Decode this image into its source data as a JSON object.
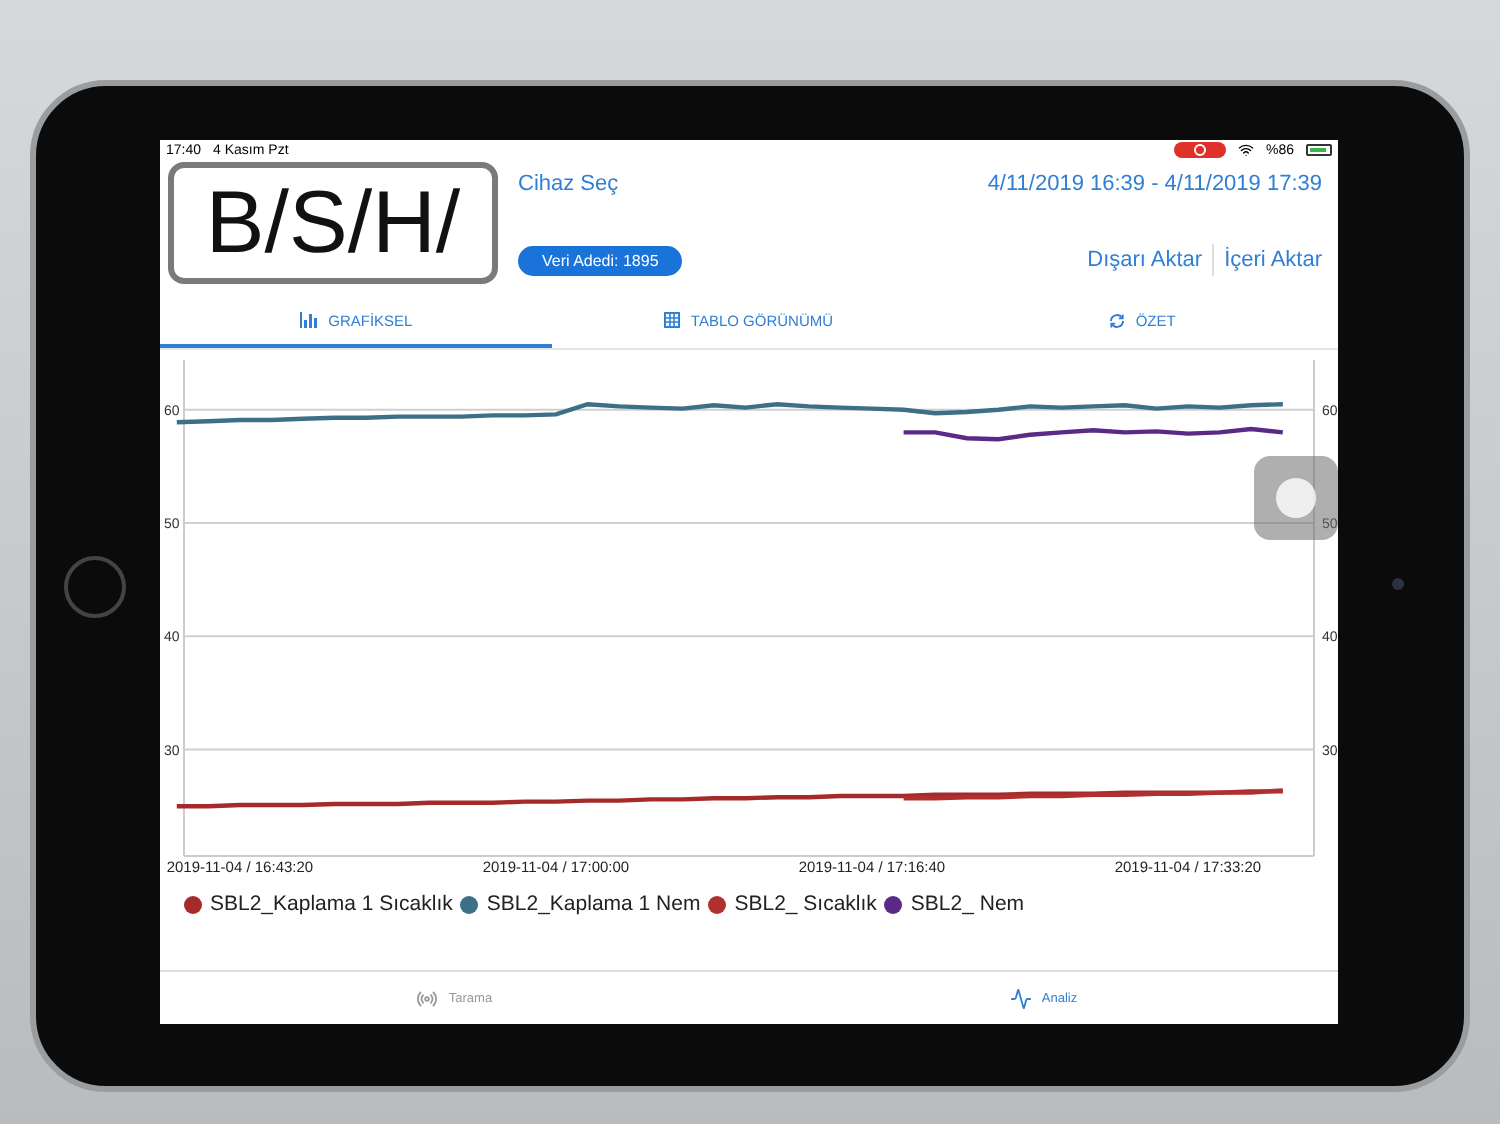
{
  "status_bar": {
    "time": "17:40",
    "date": "4 Kasım Pzt",
    "recording": true,
    "battery": "%86"
  },
  "header": {
    "logo": "B/S/H/",
    "device_select": "Cihaz Seç",
    "record_count": "Veri Adedi: 1895",
    "date_range": "4/11/2019 16:39 - 4/11/2019 17:39",
    "actions": [
      "Dışarı Aktar",
      "İçeri Aktar"
    ]
  },
  "tabs": [
    {
      "label": "GRAFİKSEL",
      "kind": "chart",
      "selected": true
    },
    {
      "label": "TABLO GÖRÜNÜMÜ",
      "kind": "table",
      "selected": false
    },
    {
      "label": "ÖZET",
      "kind": "summary",
      "selected": false
    }
  ],
  "chart": {
    "right_axis_ticks": [
      "60",
      "50",
      "40",
      "30"
    ],
    "chart_data": {
      "type": "line",
      "grid": true,
      "ylim": [
        20.6,
        64.4
      ],
      "categories": [
        null,
        null,
        "2019-11-04 / 16:43:20",
        null,
        null,
        null,
        null,
        null,
        null,
        null,
        null,
        null,
        "2019-11-04 / 17:00:00",
        null,
        null,
        null,
        null,
        null,
        null,
        null,
        null,
        null,
        "2019-11-04 / 17:16:40",
        null,
        null,
        null,
        null,
        null,
        null,
        null,
        null,
        null,
        "2019-11-04 / 17:33:20",
        null,
        null,
        null
      ],
      "yticks": [
        30,
        40,
        50,
        60
      ],
      "series": [
        {
          "name": "SBL2_Kaplama 1 Sıcaklık",
          "color": "#a52a2a",
          "values": [
            25.0,
            25.0,
            25.1,
            25.1,
            25.1,
            25.2,
            25.2,
            25.2,
            25.3,
            25.3,
            25.3,
            25.4,
            25.4,
            25.5,
            25.5,
            25.6,
            25.6,
            25.7,
            25.7,
            25.8,
            25.8,
            25.9,
            25.9,
            25.9,
            26.0,
            26.0,
            26.0,
            26.1,
            26.1,
            26.1,
            26.2,
            26.2,
            26.2,
            26.2,
            26.3,
            26.3
          ]
        },
        {
          "name": "SBL2_Kaplama 1 Nem",
          "color": "#3d6f86",
          "values": [
            58.9,
            59.0,
            59.1,
            59.1,
            59.2,
            59.3,
            59.3,
            59.4,
            59.4,
            59.4,
            59.5,
            59.5,
            59.6,
            60.5,
            60.3,
            60.2,
            60.1,
            60.4,
            60.2,
            60.5,
            60.3,
            60.2,
            60.1,
            60.0,
            59.7,
            59.8,
            60.0,
            60.3,
            60.2,
            60.3,
            60.4,
            60.1,
            60.3,
            60.2,
            60.4,
            60.5
          ]
        },
        {
          "name": "SBL2_ Sıcaklık",
          "color": "#b03030",
          "values": [
            null,
            null,
            null,
            null,
            null,
            null,
            null,
            null,
            null,
            null,
            null,
            null,
            null,
            null,
            null,
            null,
            null,
            null,
            null,
            null,
            null,
            null,
            null,
            25.7,
            25.7,
            25.8,
            25.8,
            25.9,
            25.9,
            26.0,
            26.0,
            26.1,
            26.1,
            26.2,
            26.2,
            26.4
          ]
        },
        {
          "name": "SBL2_ Nem",
          "color": "#5b2a86",
          "values": [
            null,
            null,
            null,
            null,
            null,
            null,
            null,
            null,
            null,
            null,
            null,
            null,
            null,
            null,
            null,
            null,
            null,
            null,
            null,
            null,
            null,
            null,
            null,
            58.0,
            58.0,
            57.5,
            57.4,
            57.8,
            58.0,
            58.2,
            58.0,
            58.1,
            57.9,
            58.0,
            58.3,
            58.0
          ]
        }
      ]
    }
  },
  "tab_bar": [
    {
      "label": "Tarama",
      "kind": "scan",
      "selected": false
    },
    {
      "label": "Analiz",
      "kind": "analysis",
      "selected": true
    }
  ]
}
